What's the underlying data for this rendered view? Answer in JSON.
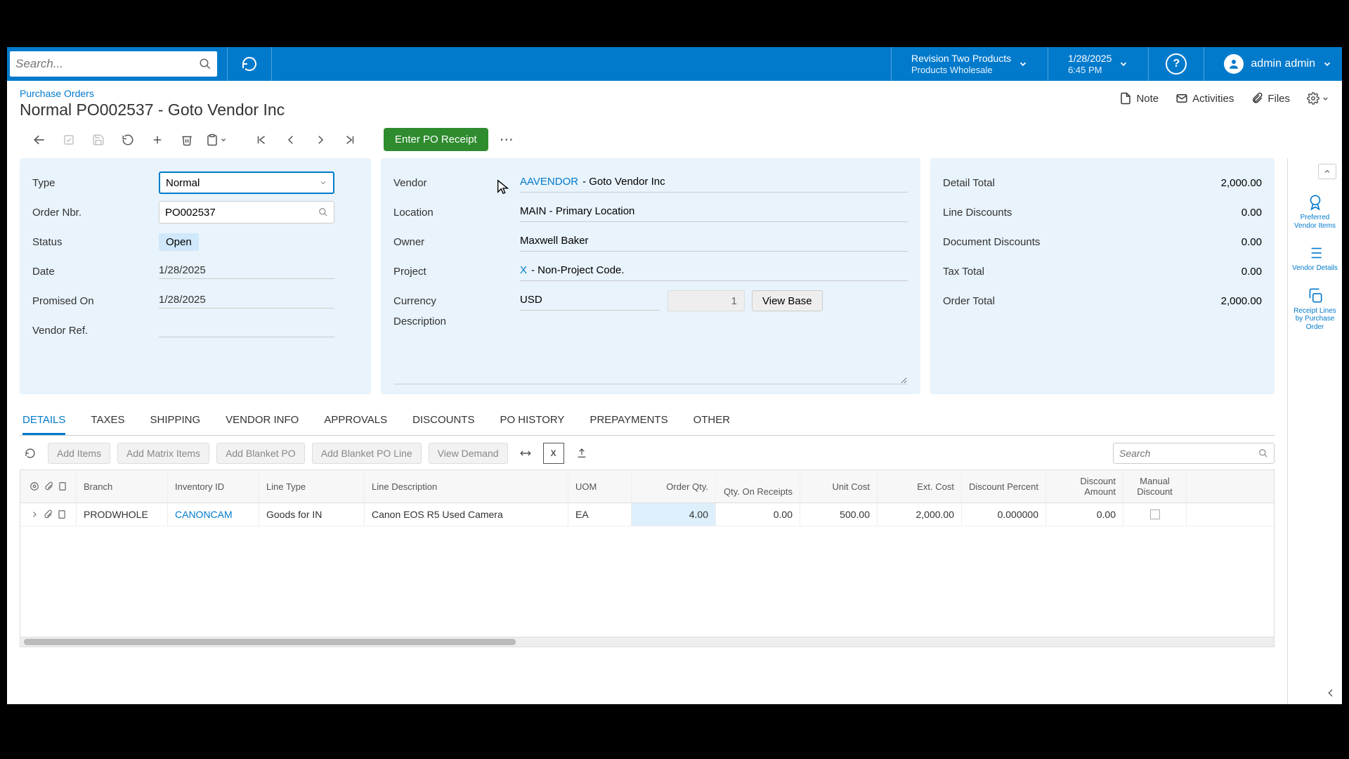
{
  "topbar": {
    "search_placeholder": "Search...",
    "company": "Revision Two Products",
    "company_sub": "Products Wholesale",
    "date": "1/28/2025",
    "time": "6:45 PM",
    "user": "admin admin"
  },
  "header": {
    "breadcrumb": "Purchase Orders",
    "title": "Normal PO002537 - Goto Vendor Inc",
    "note": "Note",
    "activities": "Activities",
    "files": "Files"
  },
  "toolbar": {
    "enter_receipt": "Enter PO Receipt"
  },
  "rail": {
    "preferred": "Preferred Vendor Items",
    "vendor_details": "Vendor Details",
    "receipt_lines": "Receipt Lines by Purchase Order"
  },
  "form": {
    "type_label": "Type",
    "type_value": "Normal",
    "order_label": "Order Nbr.",
    "order_value": "PO002537",
    "status_label": "Status",
    "status_value": "Open",
    "date_label": "Date",
    "date_value": "1/28/2025",
    "promised_label": "Promised On",
    "promised_value": "1/28/2025",
    "vendorref_label": "Vendor Ref.",
    "vendor_label": "Vendor",
    "vendor_code": "AAVENDOR",
    "vendor_name": " - Goto Vendor Inc",
    "location_label": "Location",
    "location_value": "MAIN - Primary Location",
    "owner_label": "Owner",
    "owner_value": "Maxwell Baker",
    "project_label": "Project",
    "project_code": "X",
    "project_name": " - Non-Project Code.",
    "currency_label": "Currency",
    "currency_value": "USD",
    "currency_rate": "1",
    "view_base": "View Base",
    "description_label": "Description"
  },
  "totals": {
    "detail_total_label": "Detail Total",
    "detail_total": "2,000.00",
    "line_disc_label": "Line Discounts",
    "line_disc": "0.00",
    "doc_disc_label": "Document Discounts",
    "doc_disc": "0.00",
    "tax_label": "Tax Total",
    "tax": "0.00",
    "order_total_label": "Order Total",
    "order_total": "2,000.00"
  },
  "tabs": {
    "details": "DETAILS",
    "taxes": "TAXES",
    "shipping": "SHIPPING",
    "vendor_info": "VENDOR INFO",
    "approvals": "APPROVALS",
    "discounts": "DISCOUNTS",
    "po_history": "PO HISTORY",
    "prepayments": "PREPAYMENTS",
    "other": "OTHER"
  },
  "grid_toolbar": {
    "add_items": "Add Items",
    "add_matrix": "Add Matrix Items",
    "add_blanket_po": "Add Blanket PO",
    "add_blanket_line": "Add Blanket PO Line",
    "view_demand": "View Demand",
    "search_placeholder": "Search"
  },
  "grid": {
    "headers": {
      "branch": "Branch",
      "inventory": "Inventory ID",
      "line_type": "Line Type",
      "line_desc": "Line Description",
      "uom": "UOM",
      "order_qty": "Order Qty.",
      "qty_receipts": "Qty. On Receipts",
      "unit_cost": "Unit Cost",
      "ext_cost": "Ext. Cost",
      "disc_pct": "Discount Percent",
      "disc_amt": "Discount Amount",
      "man_disc": "Manual Discount"
    },
    "rows": [
      {
        "branch": "PRODWHOLE",
        "inventory": "CANONCAM",
        "line_type": "Goods for IN",
        "line_desc": "Canon EOS R5 Used Camera",
        "uom": "EA",
        "order_qty": "4.00",
        "qty_receipts": "0.00",
        "unit_cost": "500.00",
        "ext_cost": "2,000.00",
        "disc_pct": "0.000000",
        "disc_amt": "0.00"
      }
    ]
  }
}
